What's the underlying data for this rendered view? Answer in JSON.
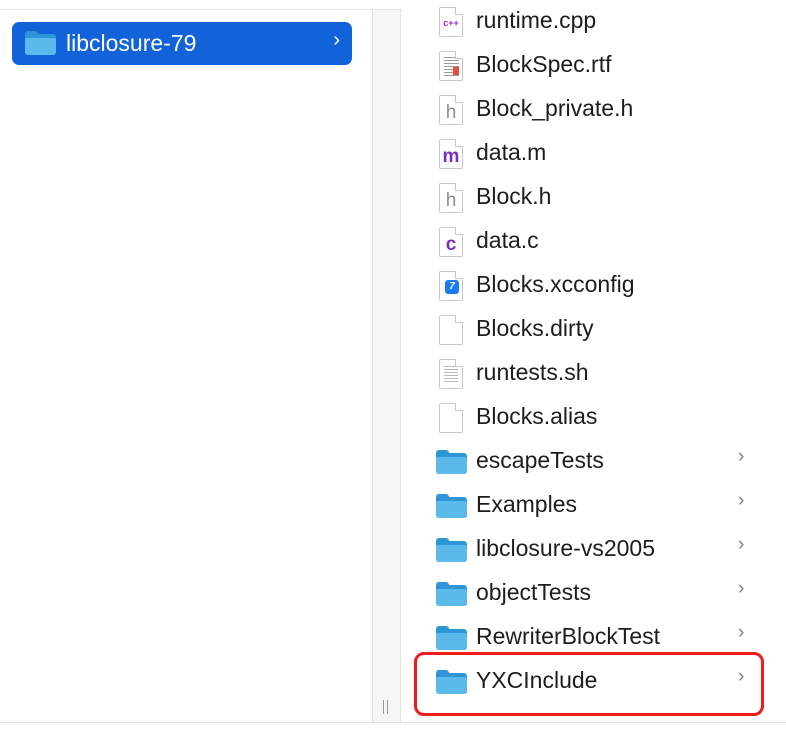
{
  "left_column": {
    "selected_item": {
      "label": "libclosure-79",
      "chevron": "›"
    }
  },
  "right_column": {
    "items": [
      {
        "label": "runtime.cpp",
        "icon": "cpp-file-icon",
        "glyph": "c++",
        "color": "#8a2be2",
        "kind": "file"
      },
      {
        "label": "BlockSpec.rtf",
        "icon": "rtf-file-icon",
        "kind": "file"
      },
      {
        "label": "Block_private.h",
        "icon": "header-file-icon",
        "glyph": "h",
        "color": "#8e8e8e",
        "kind": "file"
      },
      {
        "label": "data.m",
        "icon": "objc-file-icon",
        "glyph": "m",
        "color": "#7b2fbf",
        "kind": "file"
      },
      {
        "label": "Block.h",
        "icon": "header-file-icon",
        "glyph": "h",
        "color": "#8e8e8e",
        "kind": "file"
      },
      {
        "label": "data.c",
        "icon": "c-file-icon",
        "glyph": "c",
        "color": "#7b2fbf",
        "kind": "file"
      },
      {
        "label": "Blocks.xcconfig",
        "icon": "xcconfig-file-icon",
        "glyph": "7",
        "kind": "file"
      },
      {
        "label": "Blocks.dirty",
        "icon": "blank-file-icon",
        "kind": "file"
      },
      {
        "label": "runtests.sh",
        "icon": "script-file-icon",
        "kind": "file"
      },
      {
        "label": "Blocks.alias",
        "icon": "blank-file-icon",
        "kind": "file"
      },
      {
        "label": "escapeTests",
        "icon": "folder-icon",
        "kind": "folder",
        "chevron": "›"
      },
      {
        "label": "Examples",
        "icon": "folder-icon",
        "kind": "folder",
        "chevron": "›"
      },
      {
        "label": "libclosure-vs2005",
        "icon": "folder-icon",
        "kind": "folder",
        "chevron": "›"
      },
      {
        "label": "objectTests",
        "icon": "folder-icon",
        "kind": "folder",
        "chevron": "›"
      },
      {
        "label": "RewriterBlockTest",
        "icon": "folder-icon",
        "kind": "folder",
        "chevron": "›"
      },
      {
        "label": "YXCInclude",
        "icon": "folder-icon",
        "kind": "folder",
        "chevron": "›",
        "highlighted": true
      }
    ]
  },
  "colors": {
    "selection": "#1263d9",
    "folder_front": "#5cb9ec",
    "folder_back": "#2e96d8",
    "highlight_border": "#ee1c1c"
  }
}
